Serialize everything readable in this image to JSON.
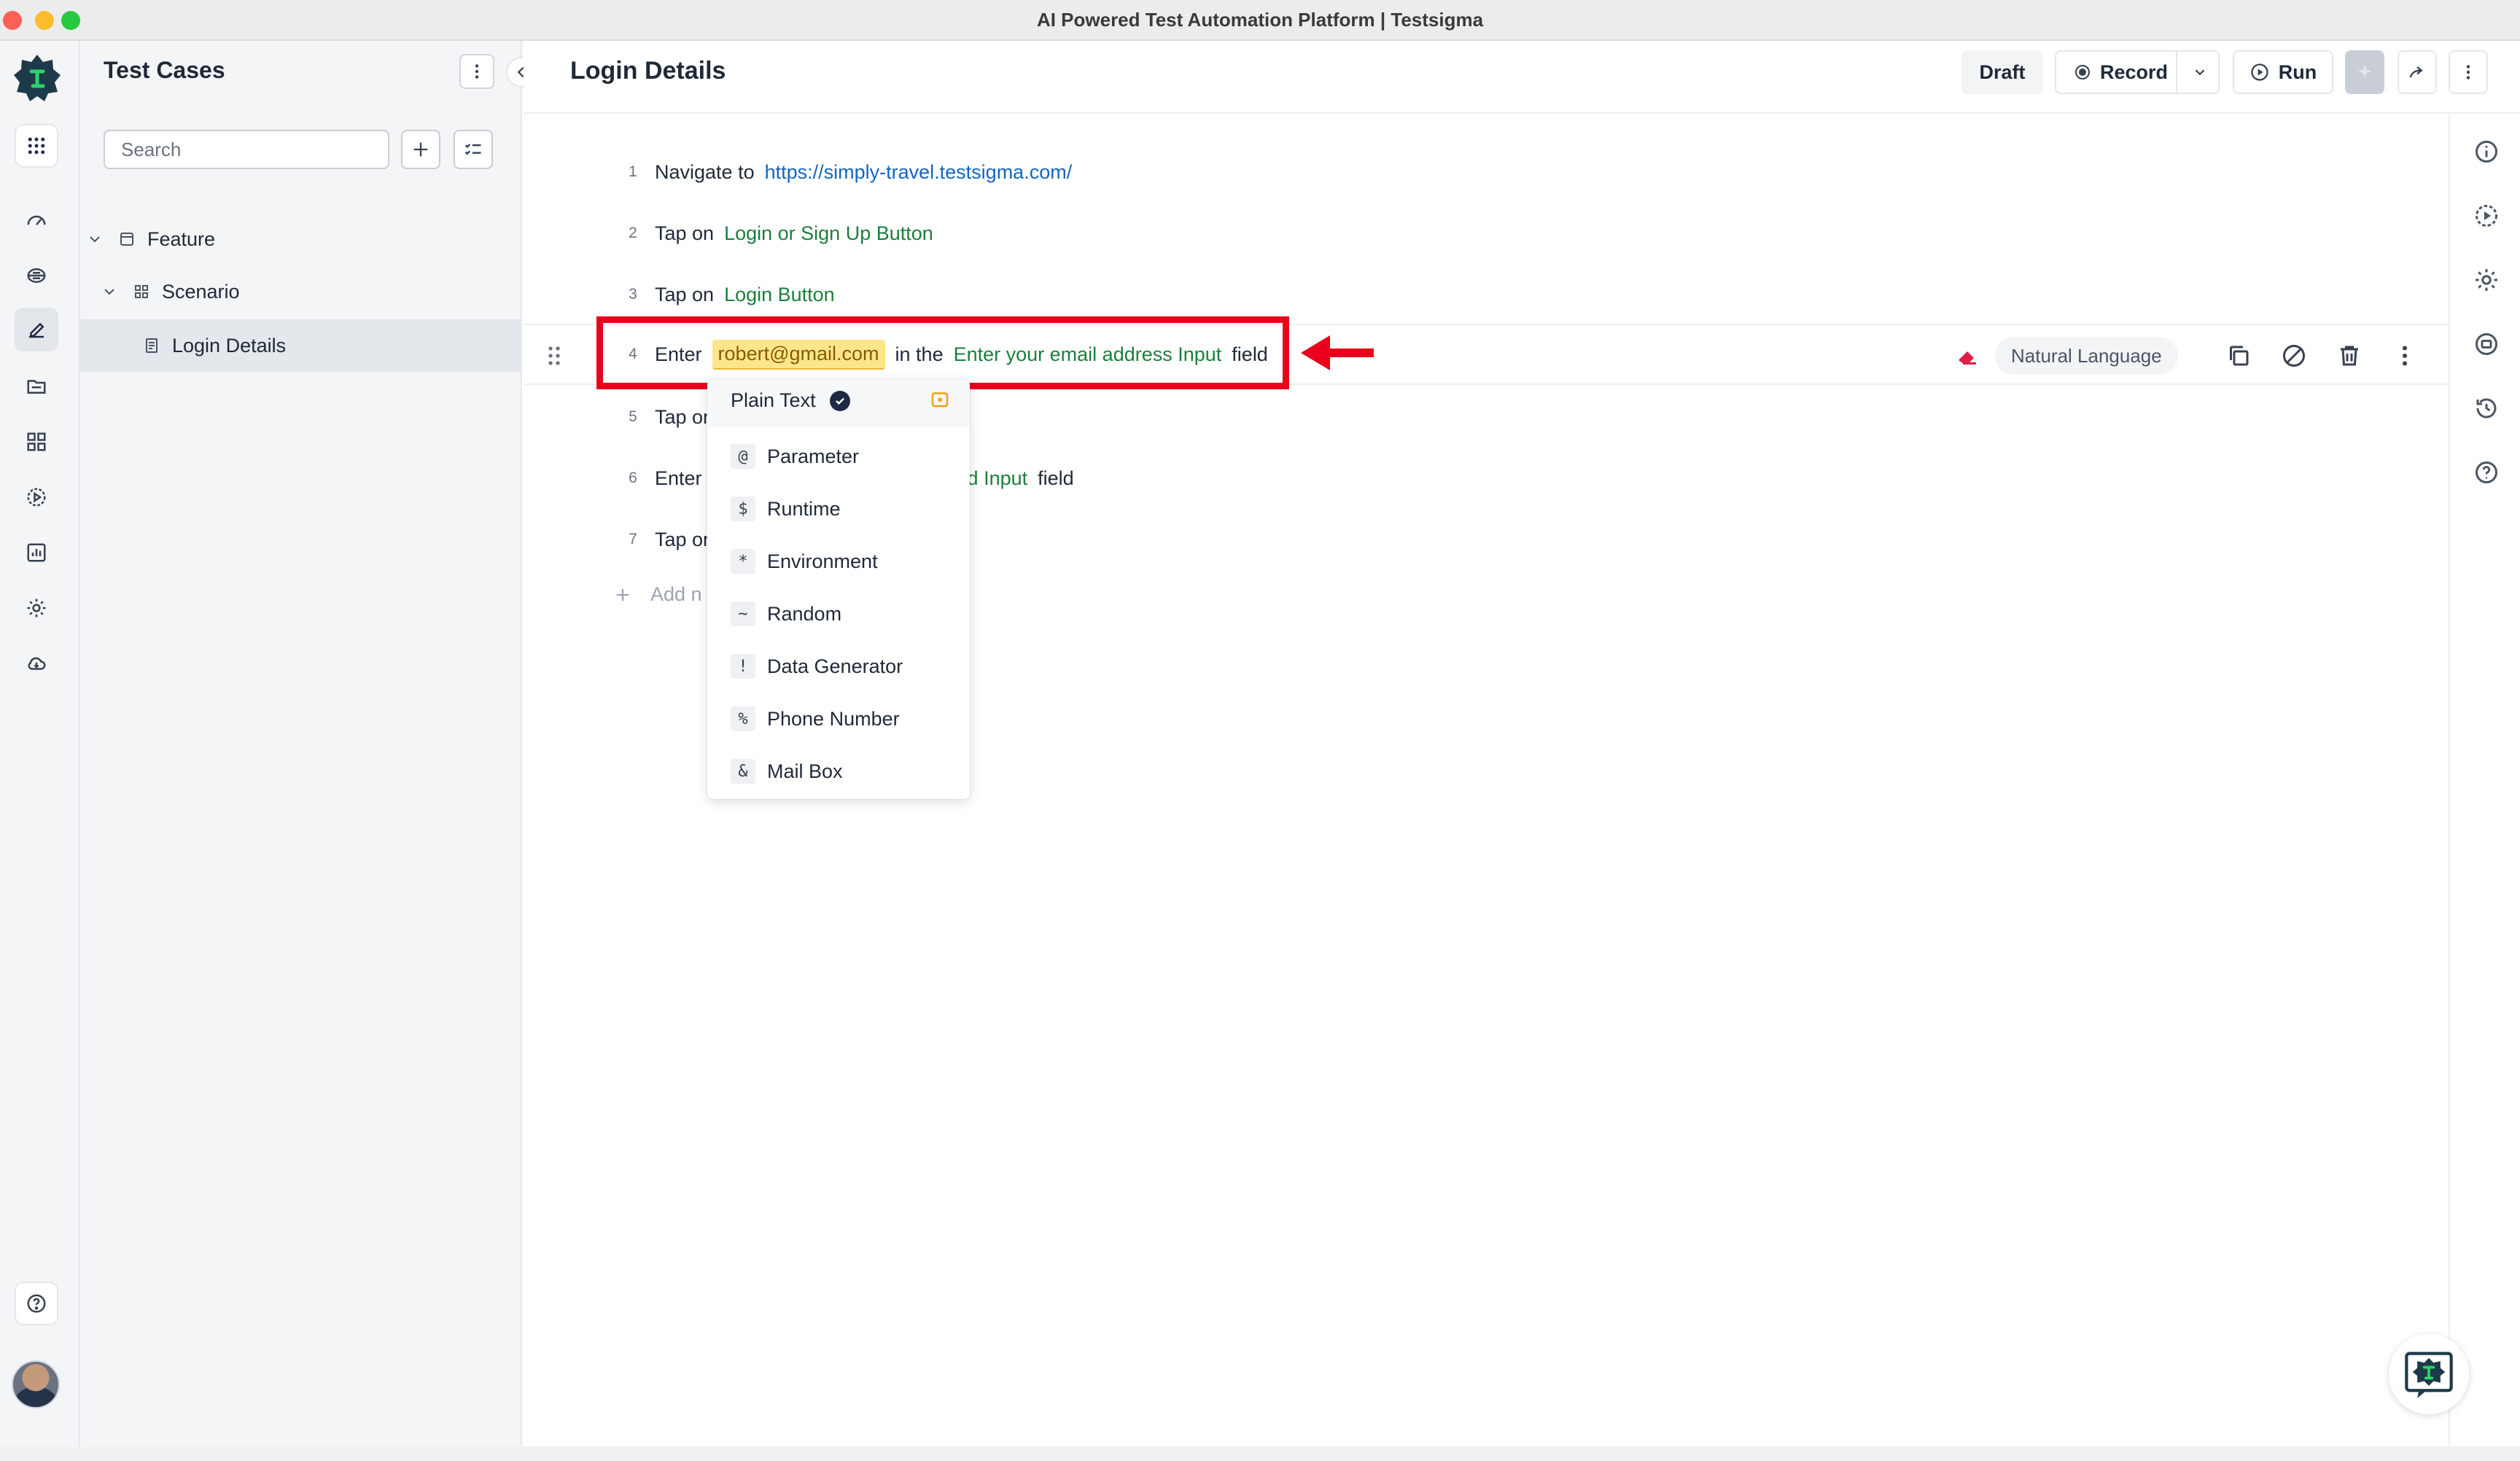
{
  "window": {
    "title": "AI Powered Test Automation Platform | Testsigma"
  },
  "panel": {
    "title": "Test Cases",
    "search_placeholder": "Search",
    "tree": [
      {
        "label": "Feature",
        "level": 0
      },
      {
        "label": "Scenario",
        "level": 1
      },
      {
        "label": "Login Details",
        "level": 2,
        "active": true
      }
    ]
  },
  "header": {
    "title": "Login Details",
    "draft": "Draft",
    "record": "Record",
    "run": "Run"
  },
  "steps": [
    {
      "num": "1",
      "parts": [
        {
          "t": "Navigate to"
        },
        {
          "t": "https://simply-travel.testsigma.com/",
          "kind": "link"
        }
      ]
    },
    {
      "num": "2",
      "parts": [
        {
          "t": "Tap on"
        },
        {
          "t": "Login or Sign Up Button",
          "kind": "element"
        }
      ]
    },
    {
      "num": "3",
      "parts": [
        {
          "t": "Tap on"
        },
        {
          "t": "Login Button",
          "kind": "element"
        }
      ]
    },
    {
      "num": "4",
      "parts": [
        {
          "t": "Enter"
        },
        {
          "t": "robert@gmail.com",
          "kind": "data"
        },
        {
          "t": "in the"
        },
        {
          "t": "Enter your email address Input",
          "kind": "element"
        },
        {
          "t": "field"
        }
      ]
    },
    {
      "num": "5",
      "parts": [
        {
          "t": "Tap on"
        }
      ]
    },
    {
      "num": "6",
      "parts": [
        {
          "t": "Enter"
        },
        {
          "t": "d Input",
          "kind": "element"
        },
        {
          "t": "field"
        }
      ]
    },
    {
      "num": "7",
      "parts": [
        {
          "t": "Tap on"
        }
      ]
    }
  ],
  "active_step": {
    "mode_label": "Natural Language"
  },
  "add_step_label": "Add n",
  "data_type_menu": {
    "selected": "Plain Text",
    "items": [
      {
        "sym": "@",
        "label": "Parameter"
      },
      {
        "sym": "$",
        "label": "Runtime"
      },
      {
        "sym": "*",
        "label": "Environment"
      },
      {
        "sym": "~",
        "label": "Random"
      },
      {
        "sym": "!",
        "label": "Data Generator"
      },
      {
        "sym": "%",
        "label": "Phone Number"
      },
      {
        "sym": "&",
        "label": "Mail Box"
      }
    ]
  },
  "colors": {
    "accent_link": "#1565c0",
    "element_green": "#1b7f3b",
    "test_data_bg": "#fde68a",
    "annotation_red": "#e8001c",
    "brand_dark": "#1e3a4a"
  }
}
